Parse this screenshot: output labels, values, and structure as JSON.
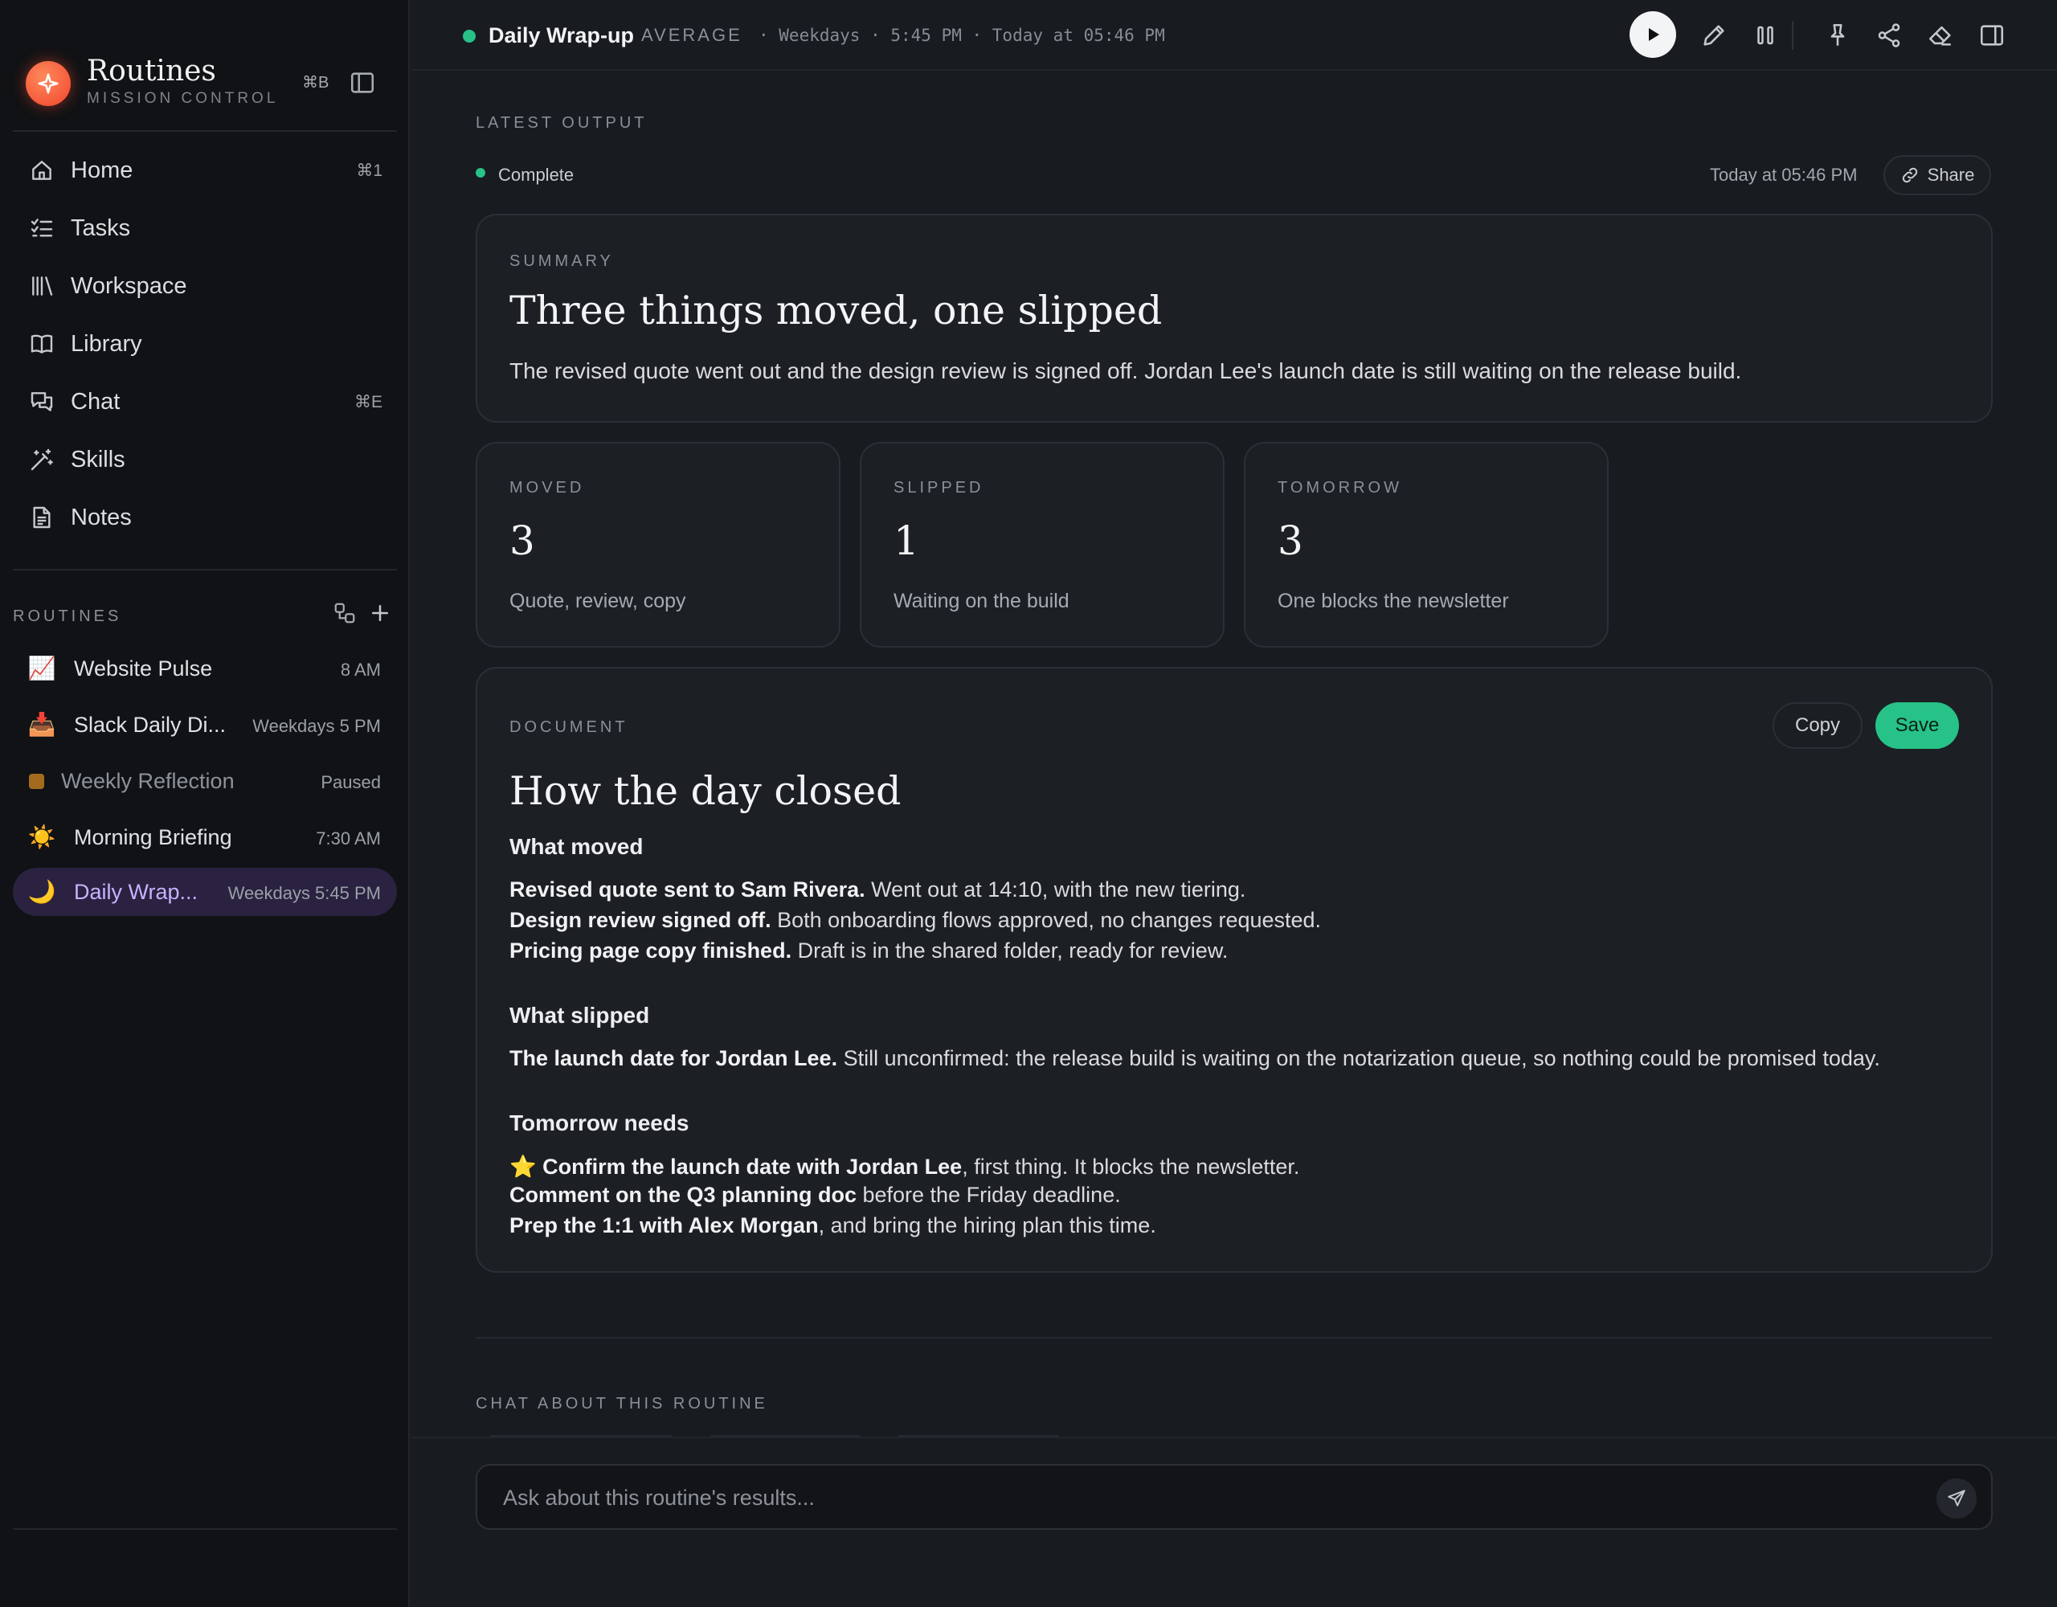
{
  "sidebar": {
    "brand_title": "Routines",
    "brand_subtitle": "MISSION CONTROL",
    "collapse_shortcut": "⌘B",
    "nav": [
      {
        "label": "Home",
        "icon": "home-icon",
        "shortcut": "⌘1"
      },
      {
        "label": "Tasks",
        "icon": "tasks-icon",
        "shortcut": ""
      },
      {
        "label": "Workspace",
        "icon": "workspace-icon",
        "shortcut": ""
      },
      {
        "label": "Library",
        "icon": "book-icon",
        "shortcut": ""
      },
      {
        "label": "Chat",
        "icon": "chat-icon",
        "shortcut": "⌘E"
      },
      {
        "label": "Skills",
        "icon": "wand-icon",
        "shortcut": ""
      },
      {
        "label": "Notes",
        "icon": "note-icon",
        "shortcut": ""
      }
    ],
    "routines_heading": "ROUTINES",
    "routines": [
      {
        "emoji": "📈",
        "label": "Website Pulse",
        "meta": "8 AM"
      },
      {
        "emoji": "📥",
        "label": "Slack Daily Di...",
        "meta": "Weekdays 5 PM"
      },
      {
        "emoji": "",
        "label": "Weekly Reflection",
        "meta": "Paused",
        "paused_color": "#a26a1d"
      },
      {
        "emoji": "☀️",
        "label": "Morning Briefing",
        "meta": "7:30 AM"
      },
      {
        "emoji": "🌙",
        "label": "Daily Wrap...",
        "meta": "Weekdays 5:45 PM",
        "active": true
      }
    ]
  },
  "topbar": {
    "title": "Daily Wrap-up",
    "badge": "AVERAGE",
    "meta": "· Weekdays · 5:45 PM · Today at 05:46 PM",
    "status_color": "#27c287"
  },
  "output": {
    "section_label": "LATEST OUTPUT",
    "status": "Complete",
    "timestamp": "Today at 05:46 PM",
    "share_label": "Share"
  },
  "summary": {
    "label": "SUMMARY",
    "title": "Three things moved, one slipped",
    "text": "The revised quote went out and the design review is signed off. Jordan Lee's launch date is still waiting on the release build."
  },
  "stats": [
    {
      "label": "MOVED",
      "value": "3",
      "desc": "Quote, review, copy"
    },
    {
      "label": "SLIPPED",
      "value": "1",
      "desc": "Waiting on the build"
    },
    {
      "label": "TOMORROW",
      "value": "3",
      "desc": "One blocks the newsletter"
    }
  ],
  "document": {
    "label": "DOCUMENT",
    "copy_label": "Copy",
    "save_label": "Save",
    "title": "How the day closed",
    "sections": [
      {
        "heading": "What moved",
        "lines": [
          {
            "prefix": "",
            "bold": "Revised quote sent to Sam Rivera.",
            "rest": " Went out at 14:10, with the new tiering."
          },
          {
            "prefix": "",
            "bold": "Design review signed off.",
            "rest": " Both onboarding flows approved, no changes requested."
          },
          {
            "prefix": "",
            "bold": "Pricing page copy finished.",
            "rest": " Draft is in the shared folder, ready for review."
          }
        ]
      },
      {
        "heading": "What slipped",
        "lines": [
          {
            "prefix": "",
            "bold": "The launch date for Jordan Lee.",
            "rest": " Still unconfirmed: the release build is waiting on the notarization queue, so nothing could be promised today."
          }
        ]
      },
      {
        "heading": "Tomorrow needs",
        "lines": [
          {
            "prefix": "⭐ ",
            "bold": "Confirm the launch date with Jordan Lee",
            "rest": ", first thing. It blocks the newsletter."
          },
          {
            "prefix": "",
            "bold": "Comment on the Q3 planning doc",
            "rest": " before the Friday deadline."
          },
          {
            "prefix": "",
            "bold": "Prep the 1:1 with Alex Morgan",
            "rest": ", and bring the hiring plan this time."
          }
        ]
      }
    ]
  },
  "chat": {
    "heading": "CHAT ABOUT THIS ROUTINE",
    "placeholder": "Ask about this routine's results..."
  },
  "colors": {
    "accent_green": "#27c287",
    "active_routine_bg": "#2a2240",
    "active_routine_text": "#c7b2ff",
    "brand_orange": "#f0442c"
  }
}
